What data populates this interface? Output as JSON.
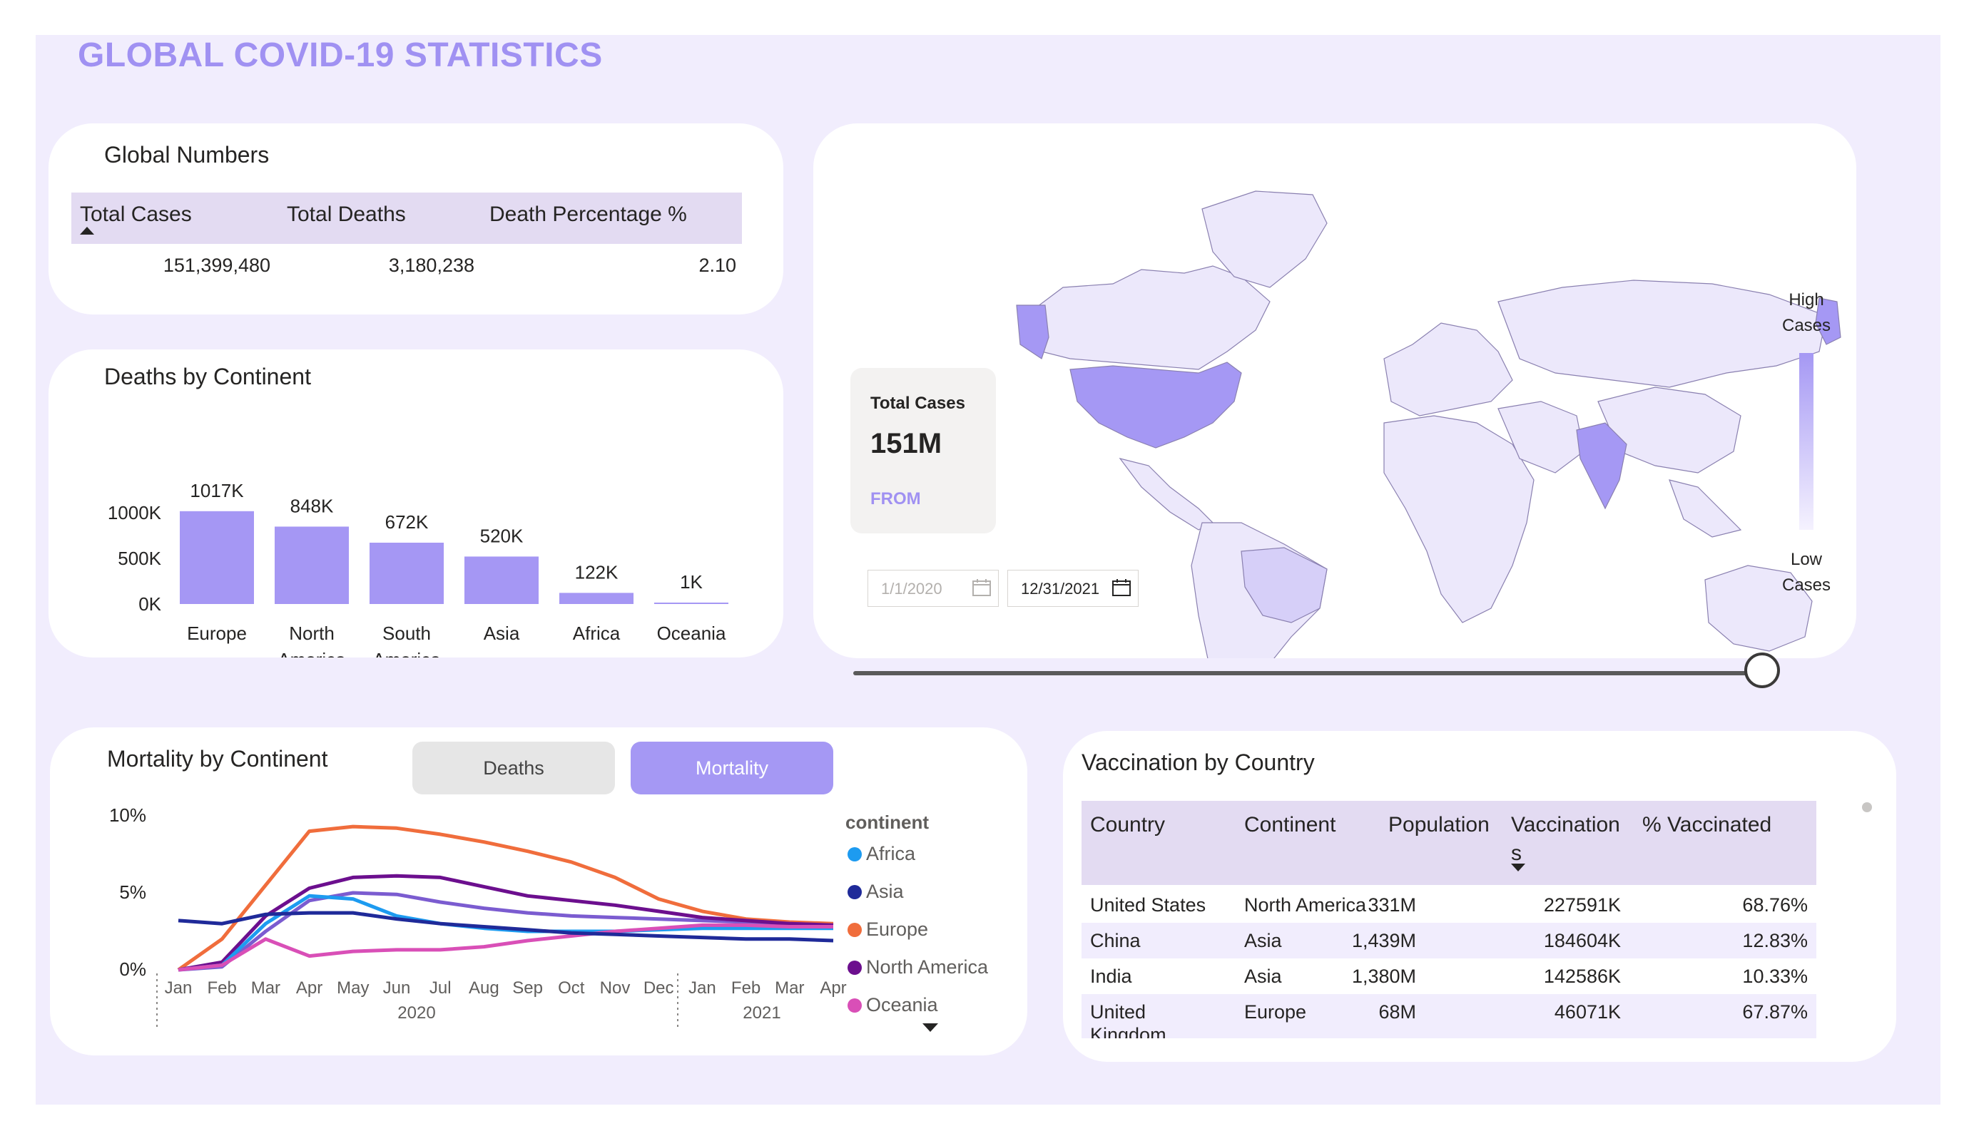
{
  "page_title": "GLOBAL COVID-19 STATISTICS",
  "global_numbers": {
    "title": "Global Numbers",
    "headers": [
      "Total Cases",
      "Total Deaths",
      "Death Percentage %"
    ],
    "values": [
      "151,399,480",
      "3,180,238",
      "2.10"
    ]
  },
  "deaths_by_continent": {
    "title": "Deaths by Continent",
    "chart_data": {
      "type": "bar",
      "categories": [
        "Europe",
        "North America",
        "South America",
        "Asia",
        "Africa",
        "Oceania"
      ],
      "category_lines": [
        [
          "Europe"
        ],
        [
          "North",
          "America"
        ],
        [
          "South",
          "America"
        ],
        [
          "Asia"
        ],
        [
          "Africa"
        ],
        [
          "Oceania"
        ]
      ],
      "values": [
        1017,
        848,
        672,
        520,
        122,
        1
      ],
      "data_labels": [
        "1017K",
        "848K",
        "672K",
        "520K",
        "122K",
        "1K"
      ],
      "y_ticks": [
        "1000K",
        "500K",
        "0K"
      ],
      "ylim": [
        0,
        1000
      ],
      "bar_color": "#a597f4"
    }
  },
  "map": {
    "total_cases_label": "Total Cases",
    "total_cases_value": "151M",
    "from_label": "FROM",
    "date_start": "1/1/2020",
    "date_end": "12/31/2021",
    "slider_value": 1.0,
    "legend_high": [
      "High",
      "Cases"
    ],
    "legend_low": [
      "Low",
      "Cases"
    ],
    "colors": {
      "high": "#a598f4",
      "low": "#ece8fb",
      "border": "#8a80b0"
    }
  },
  "mortality": {
    "title": "Mortality by Continent",
    "toggle_deaths": "Deaths",
    "toggle_mortality": "Mortality",
    "legend_title": "continent",
    "chart_data": {
      "type": "line",
      "x": [
        "Jan",
        "Feb",
        "Mar",
        "Apr",
        "May",
        "Jun",
        "Jul",
        "Aug",
        "Sep",
        "Oct",
        "Nov",
        "Dec",
        "Jan",
        "Feb",
        "Mar",
        "Apr"
      ],
      "year_labels": [
        "2020",
        "2021"
      ],
      "y_ticks": [
        "10%",
        "5%",
        "0%"
      ],
      "ylim": [
        0,
        10
      ],
      "series": [
        {
          "name": "Africa",
          "color": "#1d9bf0",
          "values": [
            0,
            0.3,
            3.0,
            4.8,
            4.6,
            3.5,
            3.0,
            2.7,
            2.5,
            2.5,
            2.5,
            2.6,
            2.7,
            2.7,
            2.7,
            2.7
          ]
        },
        {
          "name": "Asia",
          "color": "#1f2a99",
          "values": [
            3.2,
            3.0,
            3.6,
            3.7,
            3.7,
            3.3,
            3.0,
            2.8,
            2.6,
            2.4,
            2.3,
            2.2,
            2.1,
            2.0,
            2.0,
            1.9
          ]
        },
        {
          "name": "Europe",
          "color": "#f06d3c",
          "values": [
            0,
            2.0,
            5.5,
            9.0,
            9.3,
            9.2,
            8.8,
            8.3,
            7.7,
            7.0,
            6.0,
            4.6,
            3.8,
            3.3,
            3.1,
            3.0
          ]
        },
        {
          "name": "North America",
          "color": "#6c0f8e",
          "values": [
            0,
            0.5,
            3.5,
            5.3,
            6.0,
            6.1,
            6.0,
            5.4,
            4.8,
            4.5,
            4.2,
            3.8,
            3.4,
            3.2,
            3.0,
            2.9
          ]
        },
        {
          "name": "Oceania",
          "color": "#d94fb7",
          "values": [
            0,
            0.3,
            2.0,
            0.9,
            1.2,
            1.3,
            1.3,
            1.5,
            1.9,
            2.2,
            2.5,
            2.7,
            2.9,
            2.9,
            2.8,
            2.8
          ]
        },
        {
          "name": "",
          "color": "#7b5cd0",
          "values": [
            0,
            0.2,
            2.5,
            4.5,
            5.0,
            4.9,
            4.4,
            4.0,
            3.7,
            3.5,
            3.4,
            3.3,
            3.2,
            3.1,
            3.0,
            2.9
          ]
        }
      ]
    }
  },
  "vaccination": {
    "title": "Vaccination by Country",
    "headers": [
      "Country",
      "Continent",
      "Population",
      "Vaccination",
      "s",
      "% Vaccinated"
    ],
    "rows": [
      [
        "United States",
        "North America",
        "331M",
        "227591K",
        "68.76%"
      ],
      [
        "China",
        "Asia",
        "1,439M",
        "184604K",
        "12.83%"
      ],
      [
        "India",
        "Asia",
        "1,380M",
        "142586K",
        "10.33%"
      ],
      [
        "United",
        "Europe",
        "68M",
        "46071K",
        "67.87%"
      ]
    ],
    "row4_overflow": "Kingdom"
  }
}
